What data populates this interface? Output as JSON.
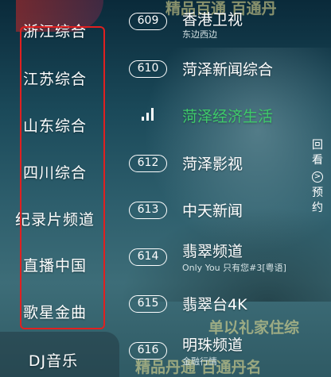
{
  "categories": [
    {
      "label": "浙江综合"
    },
    {
      "label": "江苏综合"
    },
    {
      "label": "山东综合"
    },
    {
      "label": "四川综合"
    },
    {
      "label": "纪录片频道"
    },
    {
      "label": "直播中国"
    },
    {
      "label": "歌星金曲"
    },
    {
      "label": "DJ音乐"
    }
  ],
  "channels": [
    {
      "number": "609",
      "name": "香港卫视",
      "subtitle": "东边西边"
    },
    {
      "number": "610",
      "name": "菏泽新闻综合",
      "subtitle": ""
    },
    {
      "number": "",
      "name": "菏泽经济生活",
      "subtitle": "",
      "active": true,
      "icon": "signal-bars-icon"
    },
    {
      "number": "612",
      "name": "菏泽影视",
      "subtitle": ""
    },
    {
      "number": "613",
      "name": "中天新闻",
      "subtitle": ""
    },
    {
      "number": "614",
      "name": "翡翠频道",
      "subtitle": "Only You 只有您#3[粤语]"
    },
    {
      "number": "615",
      "name": "翡翠台4K",
      "subtitle": ""
    },
    {
      "number": "616",
      "name": "明珠频道",
      "subtitle": "金融行情"
    }
  ],
  "side_actions": {
    "replay_label": "回看",
    "reserve_label": "预约",
    "arrow_icon": "chevron-right-icon"
  },
  "watermarks": {
    "top": "精品百通 百通丹",
    "bottom_line1": "单以礼家住综",
    "bottom_line2": "精品丹通 百通丹名"
  },
  "colors": {
    "active_channel": "#3ecb6a",
    "highlight_box": "#e02020"
  }
}
